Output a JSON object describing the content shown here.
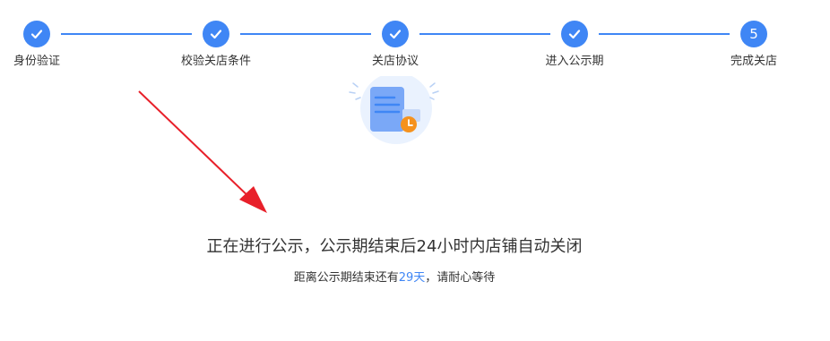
{
  "colors": {
    "accent": "#3f86f5",
    "arrow": "#e8202a",
    "clock": "#f5921e"
  },
  "steps": [
    {
      "label": "身份验证",
      "status": "done",
      "icon": "check-icon"
    },
    {
      "label": "校验关店条件",
      "status": "done",
      "icon": "check-icon"
    },
    {
      "label": "关店协议",
      "status": "done",
      "icon": "check-icon"
    },
    {
      "label": "进入公示期",
      "status": "done",
      "icon": "check-icon"
    },
    {
      "label": "完成关店",
      "status": "current",
      "number": "5"
    }
  ],
  "illustration": {
    "icon": "document-clock-icon"
  },
  "message": {
    "title": "正在进行公示，公示期结束后24小时内店铺自动关闭",
    "sub_prefix": "距离公示期结束还有",
    "days": "29天",
    "sub_suffix": "，请耐心等待"
  }
}
